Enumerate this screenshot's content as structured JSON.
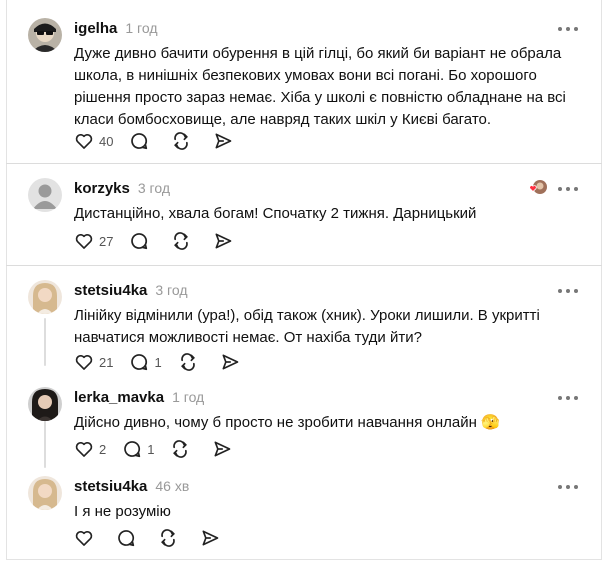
{
  "comments": [
    {
      "username": "igelha",
      "time": "1 год",
      "text": "Дуже дивно бачити обурення в цій гілці, бо який би варіант не обрала школа, в нинішніх безпекових умовах вони всі погані. Бо хорошого рішення просто зараз немає. Хіба у школі є повністю обладнане на всі класи бомбосховище, але навряд таких шкіл у Києві багато.",
      "likes": "40",
      "replies": ""
    },
    {
      "username": "korzyks",
      "time": "3 год",
      "text": "Дистанційно, хвала богам! Спочатку 2 тижня. Дарницький",
      "likes": "27",
      "replies": ""
    },
    {
      "username": "stetsiu4ka",
      "time": "3 год",
      "text": "Лінійку відмінили (ура!), обід також (хник). Уроки лишили. В укритті навчатися можливості немає. От нахіба туди йти?",
      "likes": "21",
      "replies": "1"
    },
    {
      "username": "lerka_mavka",
      "time": "1 год",
      "text": "Дійсно дивно, чому б просто не зробити навчання онлайн 🫣",
      "likes": "2",
      "replies": "1"
    },
    {
      "username": "stetsiu4ka",
      "time": "46 хв",
      "text": "І я не розумію",
      "likes": "",
      "replies": ""
    }
  ],
  "icons": {
    "like": "heart-icon",
    "reply": "comment-bubble-icon",
    "repost": "repost-icon",
    "share": "send-icon",
    "more": "more-dots-icon"
  },
  "colors": {
    "username": "#101010",
    "time": "#999999",
    "separator": "#dcdcdc",
    "like_badge": "#ff3040"
  }
}
